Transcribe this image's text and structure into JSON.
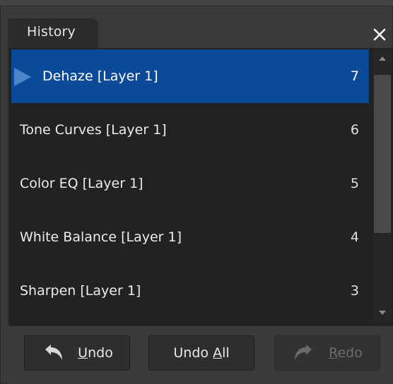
{
  "panel": {
    "tab_label": "History",
    "close_glyph": "✕"
  },
  "history": {
    "items": [
      {
        "label": "Dehaze [Layer 1]",
        "step": "7",
        "selected": true
      },
      {
        "label": "Tone Curves [Layer 1]",
        "step": "6",
        "selected": false
      },
      {
        "label": "Color EQ [Layer 1]",
        "step": "5",
        "selected": false
      },
      {
        "label": "White Balance [Layer 1]",
        "step": "4",
        "selected": false
      },
      {
        "label": "Sharpen [Layer 1]",
        "step": "3",
        "selected": false
      }
    ]
  },
  "buttons": {
    "undo": {
      "label": "Undo",
      "mnemonic": "U"
    },
    "undo_all": {
      "label": "Undo All",
      "mnemonic": "A"
    },
    "redo": {
      "label": "Redo",
      "mnemonic": "R",
      "disabled": true
    }
  },
  "colors": {
    "selection": "#0a4a99",
    "marker": "#4a86c8",
    "list_bg": "#222222",
    "chrome": "#3a3a3a"
  },
  "icons": {
    "close": "close-icon",
    "current_marker": "play-marker-icon",
    "undo": "undo-arrow-icon",
    "redo": "redo-arrow-icon",
    "scroll_up": "chevron-up-icon",
    "scroll_down": "chevron-down-icon"
  }
}
